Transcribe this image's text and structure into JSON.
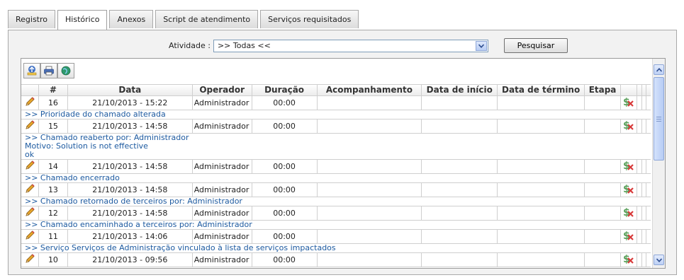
{
  "tabs": [
    "Registro",
    "Histórico",
    "Anexos",
    "Script de atendimento",
    "Serviços requisitados"
  ],
  "active_tab": "Histórico",
  "filter": {
    "label": "Atividade :",
    "selected": ">> Todas <<",
    "button": "Pesquisar"
  },
  "toolbar_icons": [
    "export-icon",
    "print-icon",
    "globe-icon"
  ],
  "columns": [
    "#",
    "Data",
    "Operador",
    "Duração",
    "Acompanhamento",
    "Data de início",
    "Data de término",
    "Etapa"
  ],
  "rows": [
    {
      "num": "16",
      "date": "21/10/2013 - 15:22",
      "operator": "Administrador",
      "duration": "00:00",
      "note": [
        ">> Prioridade do chamado alterada"
      ]
    },
    {
      "num": "15",
      "date": "21/10/2013 - 14:58",
      "operator": "Administrador",
      "duration": "00:00",
      "note": [
        ">> Chamado reaberto por: Administrador",
        "Motivo: Solution is not effective",
        "ok"
      ]
    },
    {
      "num": "14",
      "date": "21/10/2013 - 14:58",
      "operator": "Administrador",
      "duration": "00:00",
      "note": [
        ">> Chamado encerrado"
      ]
    },
    {
      "num": "13",
      "date": "21/10/2013 - 14:58",
      "operator": "Administrador",
      "duration": "00:00",
      "note": [
        ">> Chamado retornado de terceiros por: Administrador"
      ]
    },
    {
      "num": "12",
      "date": "21/10/2013 - 14:58",
      "operator": "Administrador",
      "duration": "00:00",
      "note": [
        ">> Chamado encaminhado a terceiros por: Administrador"
      ]
    },
    {
      "num": "11",
      "date": "21/10/2013 - 14:06",
      "operator": "Administrador",
      "duration": "00:00",
      "note": [
        ">> Serviço Serviços de Administração vinculado à lista de serviços impactados"
      ]
    },
    {
      "num": "10",
      "date": "21/10/2013 - 09:56",
      "operator": "Administrador",
      "duration": "00:00",
      "note": []
    }
  ],
  "colors": {
    "note_text": "#1d5aa0",
    "panel_bg": "#f2f2f2",
    "border": "#a9a9a9"
  }
}
